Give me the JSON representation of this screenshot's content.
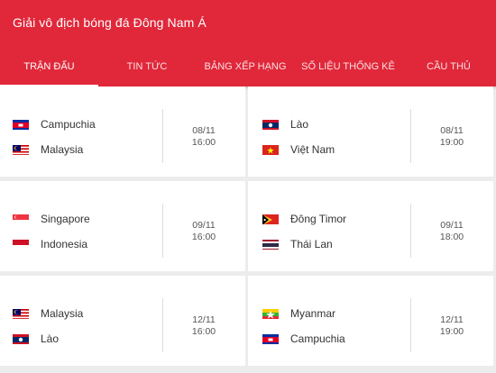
{
  "header": {
    "title": "Giải vô địch bóng đá Đông Nam Á",
    "accent_color": "#e0283a"
  },
  "tabs": [
    {
      "label": "TRẬN ĐẤU",
      "active": true
    },
    {
      "label": "TIN TỨC",
      "active": false
    },
    {
      "label": "BẢNG XẾP HẠNG",
      "active": false
    },
    {
      "label": "SỐ LIỆU THỐNG KÊ",
      "active": false
    },
    {
      "label": "CẦU THỦ",
      "active": false
    }
  ],
  "matches": [
    {
      "home": "Campuchia",
      "home_flag": "cambodia-flag-icon",
      "away": "Malaysia",
      "away_flag": "malaysia-flag-icon",
      "date": "08/11",
      "time": "16:00"
    },
    {
      "home": "Lào",
      "home_flag": "laos-flag-icon",
      "away": "Việt Nam",
      "away_flag": "vietnam-flag-icon",
      "date": "08/11",
      "time": "19:00"
    },
    {
      "home": "Singapore",
      "home_flag": "singapore-flag-icon",
      "away": "Indonesia",
      "away_flag": "indonesia-flag-icon",
      "date": "09/11",
      "time": "16:00"
    },
    {
      "home": "Đông Timor",
      "home_flag": "east-timor-flag-icon",
      "away": "Thái Lan",
      "away_flag": "thailand-flag-icon",
      "date": "09/11",
      "time": "18:00"
    },
    {
      "home": "Malaysia",
      "home_flag": "malaysia-flag-icon",
      "away": "Lào",
      "away_flag": "laos-flag-icon",
      "date": "12/11",
      "time": "16:00"
    },
    {
      "home": "Myanmar",
      "home_flag": "myanmar-flag-icon",
      "away": "Campuchia",
      "away_flag": "cambodia-flag-icon",
      "date": "12/11",
      "time": "19:00"
    }
  ]
}
